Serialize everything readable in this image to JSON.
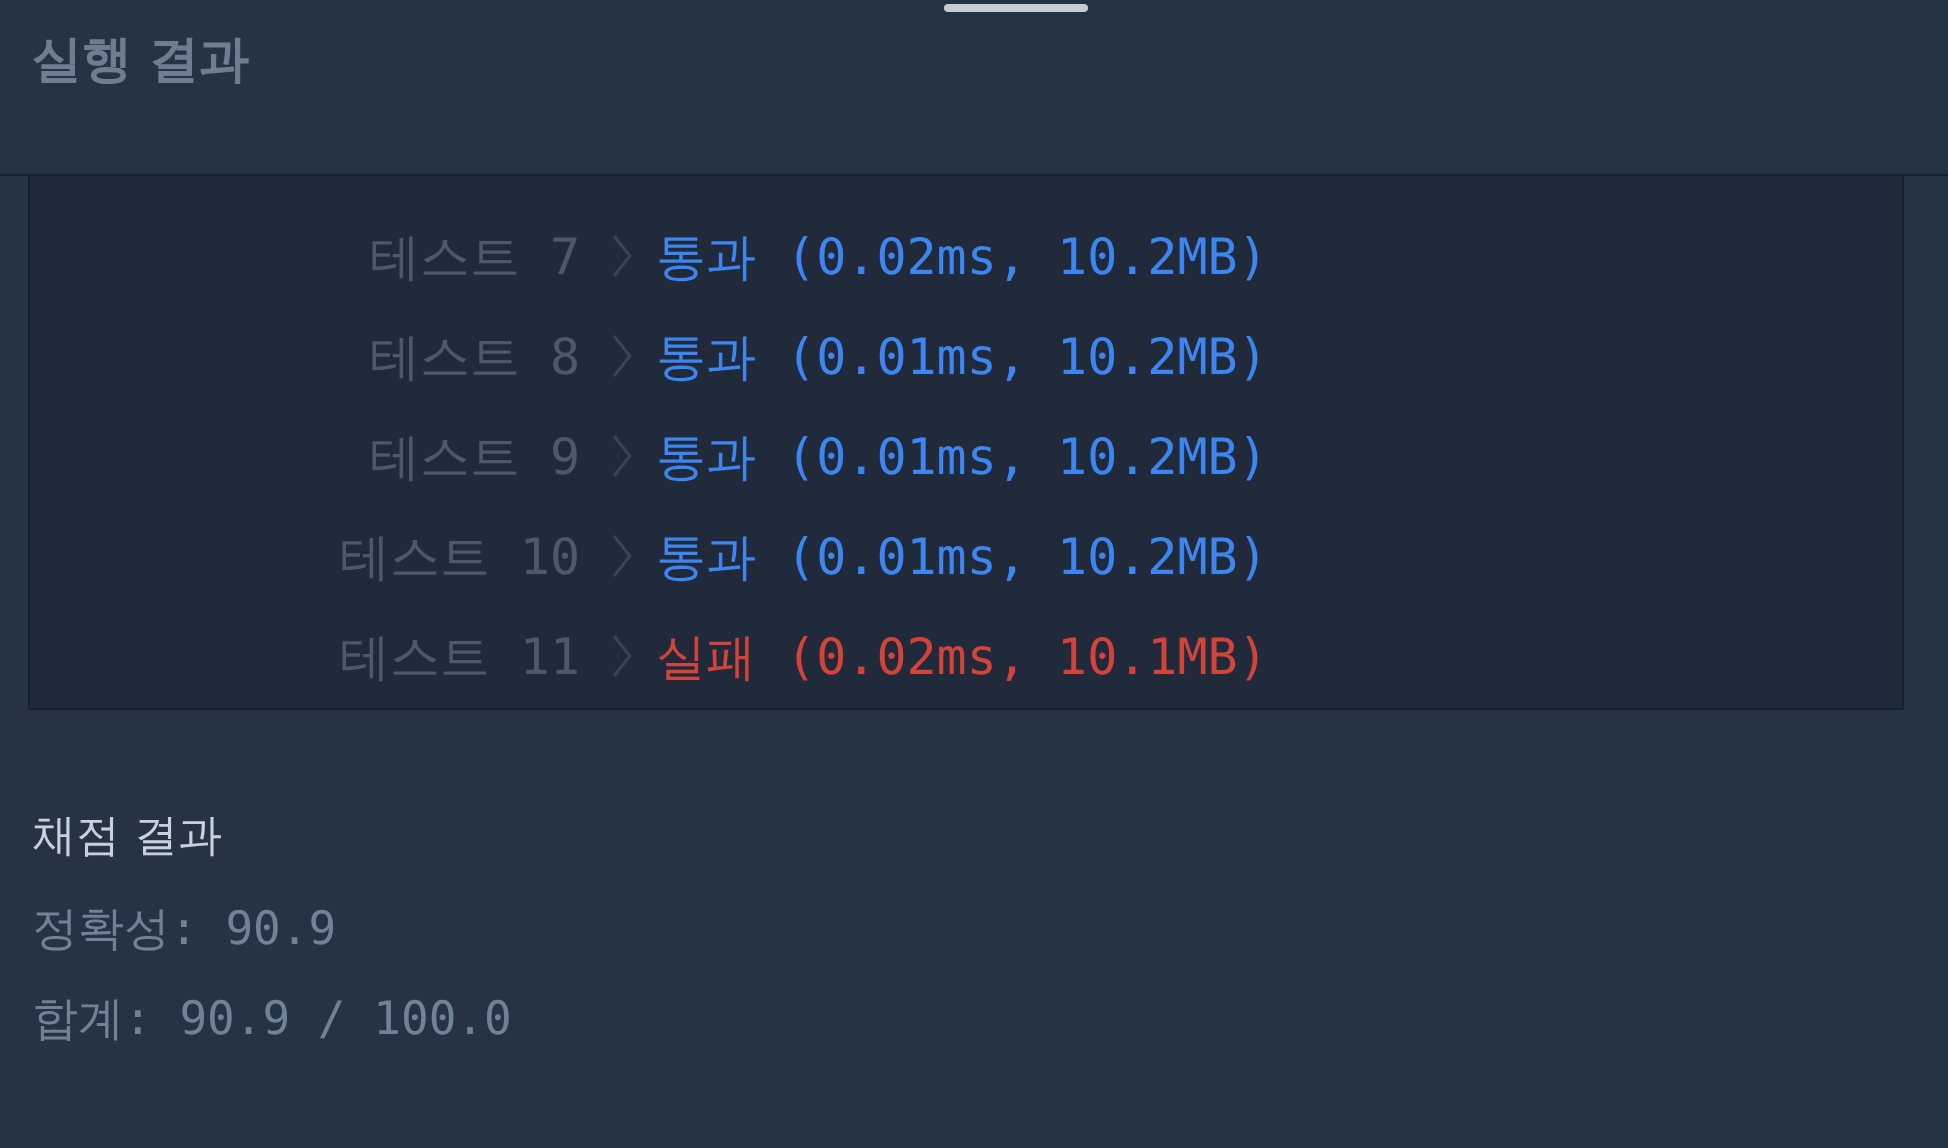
{
  "panel": {
    "title": "실행 결과"
  },
  "results": [
    {
      "label": "테스트 7",
      "kind": "pass",
      "status": "통과",
      "detail": "(0.02ms, 10.2MB)"
    },
    {
      "label": "테스트 8",
      "kind": "pass",
      "status": "통과",
      "detail": "(0.01ms, 10.2MB)"
    },
    {
      "label": "테스트 9",
      "kind": "pass",
      "status": "통과",
      "detail": "(0.01ms, 10.2MB)"
    },
    {
      "label": "테스트 10",
      "kind": "pass",
      "status": "통과",
      "detail": "(0.01ms, 10.2MB)"
    },
    {
      "label": "테스트 11",
      "kind": "fail",
      "status": "실패",
      "detail": "(0.02ms, 10.1MB)"
    }
  ],
  "grading": {
    "title": "채점 결과",
    "lines": [
      "정확성: 90.9",
      "합계: 90.9 / 100.0"
    ]
  }
}
